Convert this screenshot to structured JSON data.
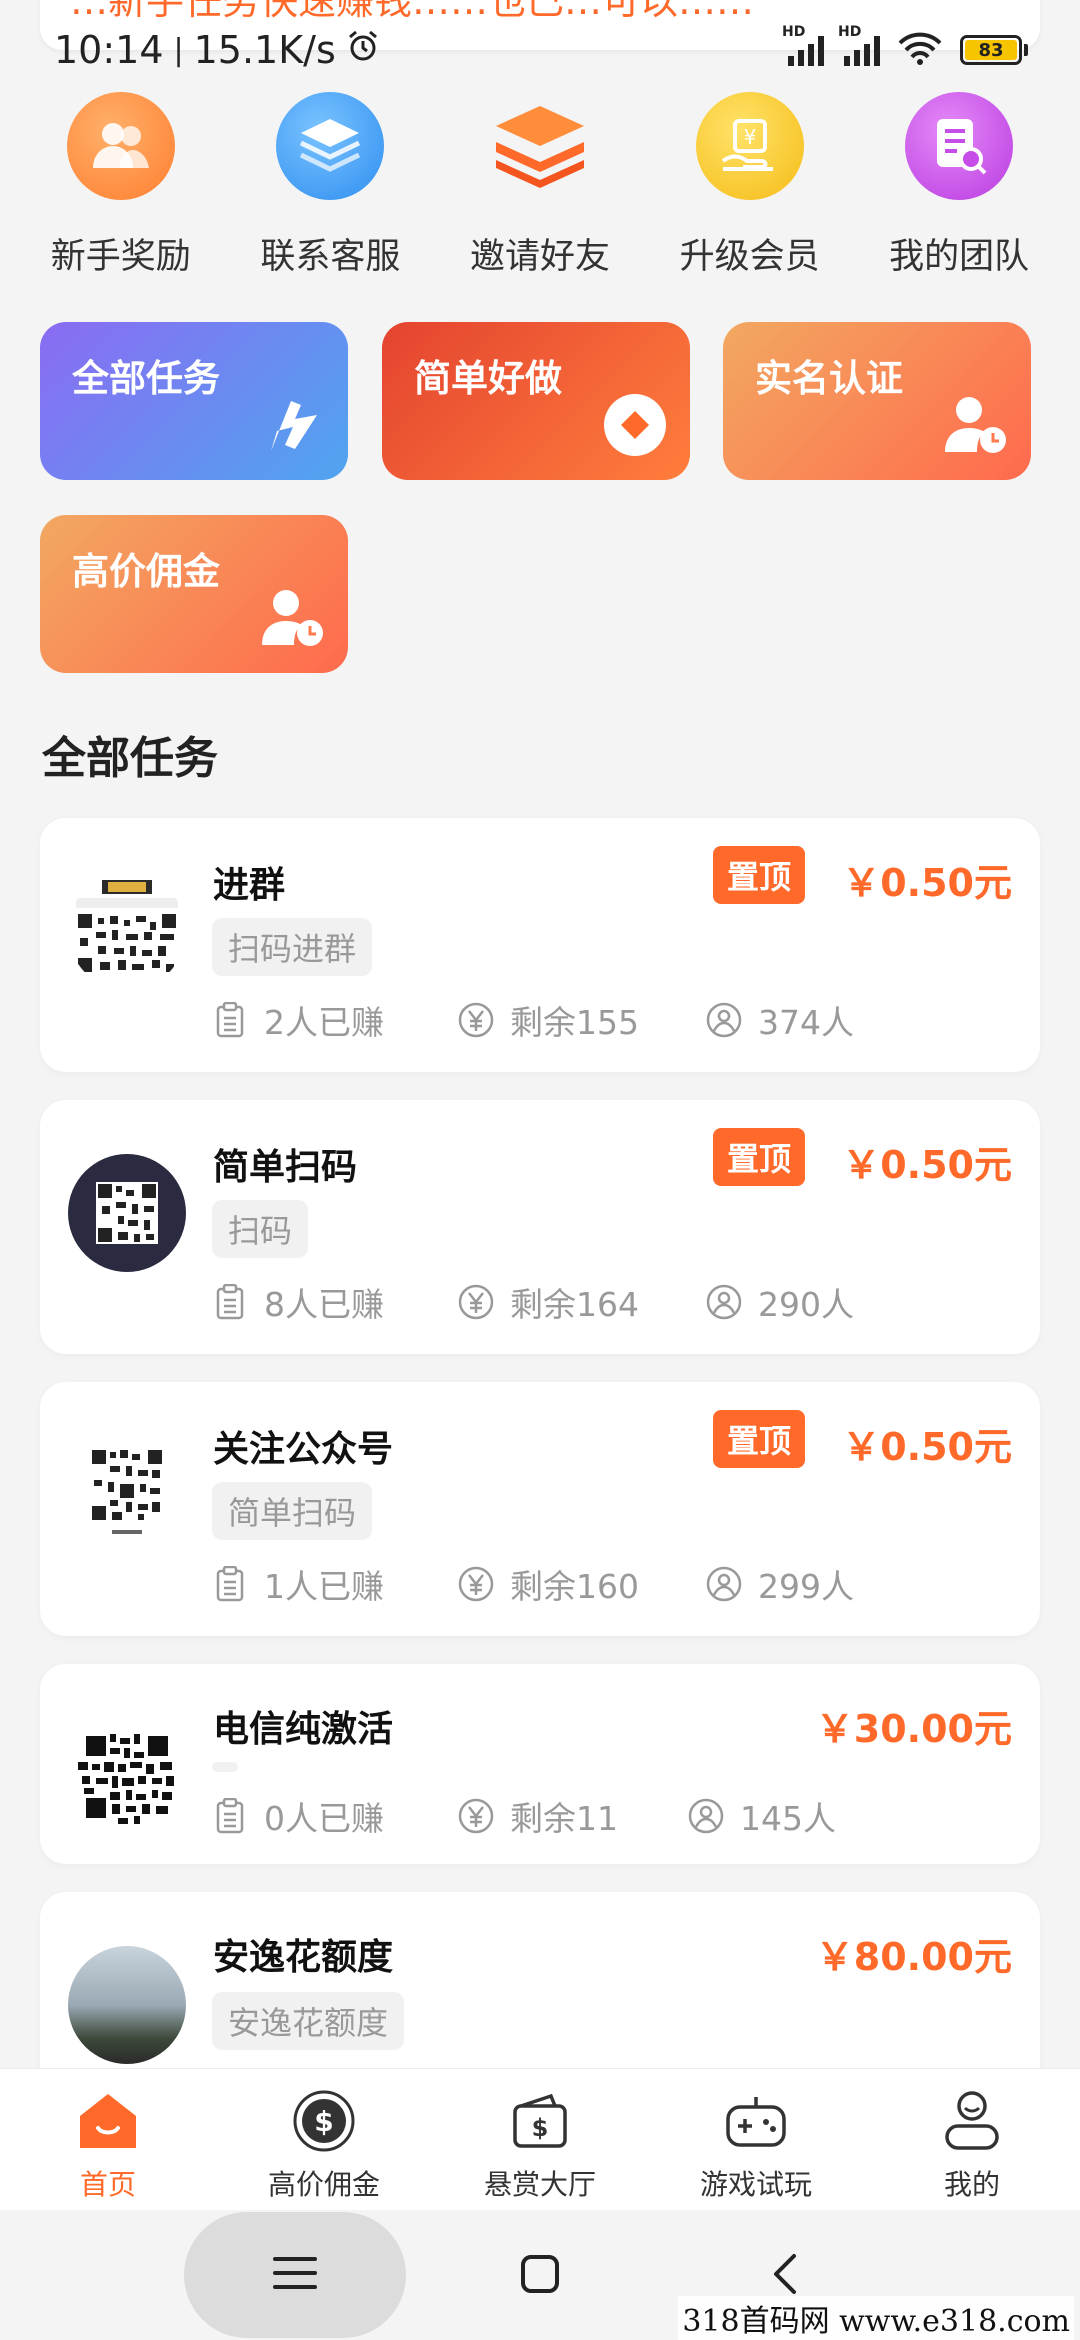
{
  "top_banner": {
    "text": "…新手任务快速赚钱……也已…可以……"
  },
  "status_bar": {
    "time": "10:14",
    "speed": "15.1K/s",
    "battery": "83",
    "hd_label": "HD"
  },
  "quick_menu": [
    {
      "label": "新手奖励",
      "icon": "people-icon",
      "color": "#ff8a3d"
    },
    {
      "label": "联系客服",
      "icon": "layers-icon",
      "color": "#3d9df2"
    },
    {
      "label": "邀请好友",
      "icon": "stack-icon",
      "color": "#ff7a2f"
    },
    {
      "label": "升级会员",
      "icon": "vip-hand-icon",
      "color": "#f7c52b"
    },
    {
      "label": "我的团队",
      "icon": "doc-search-icon",
      "color": "#c64de8"
    }
  ],
  "categories": [
    {
      "label": "全部任务",
      "icon": "flag-icon",
      "gradient": [
        "#8b6bf2",
        "#4fa5f0"
      ]
    },
    {
      "label": "简单好做",
      "icon": "diamond-coin-icon",
      "gradient": [
        "#e4432f",
        "#ff7e3d"
      ]
    },
    {
      "label": "实名认证",
      "icon": "user-clock-icon",
      "gradient": [
        "#f2a861",
        "#ff6a4d"
      ]
    },
    {
      "label": "高价佣金",
      "icon": "user-clock-icon",
      "gradient": [
        "#f2a861",
        "#ff6a4d"
      ]
    }
  ],
  "section_title": "全部任务",
  "tasks": [
    {
      "title": "进群",
      "top": "置顶",
      "price": "￥0.50元",
      "tag": "扫码进群",
      "earned": "2人已赚",
      "remaining": "剩余155",
      "people": "374人"
    },
    {
      "title": "简单扫码",
      "top": "置顶",
      "price": "￥0.50元",
      "tag": "扫码",
      "earned": "8人已赚",
      "remaining": "剩余164",
      "people": "290人"
    },
    {
      "title": "关注公众号",
      "top": "置顶",
      "price": "￥0.50元",
      "tag": "简单扫码",
      "earned": "1人已赚",
      "remaining": "剩余160",
      "people": "299人"
    },
    {
      "title": "电信纯激活",
      "top": "",
      "price": "￥30.00元",
      "tag": "",
      "earned": "0人已赚",
      "remaining": "剩余11",
      "people": "145人"
    },
    {
      "title": "安逸花额度",
      "top": "",
      "price": "￥80.00元",
      "tag": "安逸花额度",
      "earned": "",
      "remaining": "",
      "people": ""
    }
  ],
  "bottom_nav": [
    {
      "label": "首页",
      "icon": "home-icon",
      "active": true
    },
    {
      "label": "高价佣金",
      "icon": "dollar-coin-icon",
      "active": false
    },
    {
      "label": "悬赏大厅",
      "icon": "wallet-dollar-icon",
      "active": false
    },
    {
      "label": "游戏试玩",
      "icon": "gamepad-icon",
      "active": false
    },
    {
      "label": "我的",
      "icon": "profile-icon",
      "active": false
    }
  ],
  "accent_color": "#ff6a2a",
  "watermark": "318首码网  www.e318.com"
}
